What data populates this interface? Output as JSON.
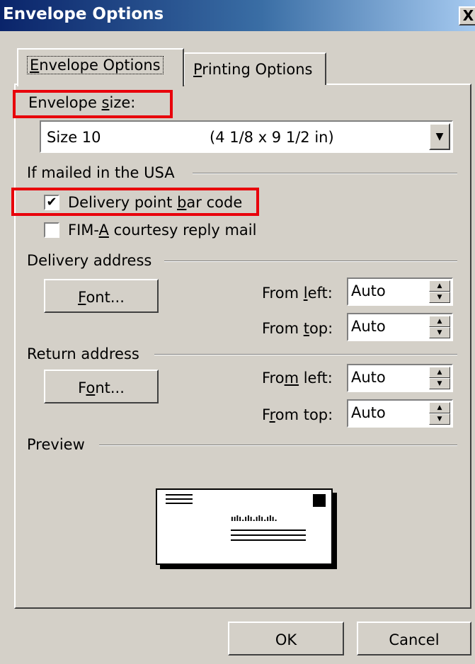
{
  "window": {
    "title": "Envelope Options",
    "close_glyph": "X"
  },
  "tabs": [
    {
      "label": "Envelope Options",
      "mnemonic": "E",
      "rest": "nvelope Options",
      "active": true
    },
    {
      "label": "Printing Options",
      "mnemonic": "P",
      "rest": "rinting Options",
      "active": false
    }
  ],
  "envelope_size": {
    "label_pre": "Envelope ",
    "label_mn": "s",
    "label_post": "ize:",
    "value_name": "Size 10",
    "value_dims": "(4 1/8 x 9 1/2 in)"
  },
  "usa_group": {
    "title": "If mailed in the USA",
    "delivery_barcode": {
      "pre": "Delivery point ",
      "mn": "b",
      "post": "ar code",
      "checked": true,
      "check_glyph": "✔"
    },
    "fim": {
      "pre": "FIM-",
      "mn": "A",
      "post": " courtesy reply mail",
      "checked": false
    }
  },
  "delivery_address": {
    "title": "Delivery address",
    "font_button": {
      "mn": "F",
      "post": "ont..."
    },
    "from_left": {
      "pre": "From ",
      "mn": "l",
      "post": "eft:",
      "value": "Auto"
    },
    "from_top": {
      "pre": "From ",
      "mn": "t",
      "post": "op:",
      "value": "Auto"
    }
  },
  "return_address": {
    "title": "Return address",
    "font_button": {
      "pre": "F",
      "mn": "o",
      "post": "nt..."
    },
    "from_left": {
      "pre": "Fro",
      "mn": "m",
      "post": " left:",
      "value": "Auto"
    },
    "from_top": {
      "pre": "F",
      "mn": "r",
      "post": "om top:",
      "value": "Auto"
    }
  },
  "preview": {
    "title": "Preview",
    "barcode_glyphs": "ıılı.ılı.ılı.ılı."
  },
  "footer": {
    "ok_label": "OK",
    "cancel_label": "Cancel"
  },
  "colors": {
    "highlight": "#e8000b",
    "title_bar": "#0a246a",
    "face": "#d4d0c8"
  },
  "icons": {
    "close": "close-icon",
    "combo_arrow": "chevron-down-icon",
    "spin_up": "arrow-up-icon",
    "spin_down": "arrow-down-icon"
  }
}
